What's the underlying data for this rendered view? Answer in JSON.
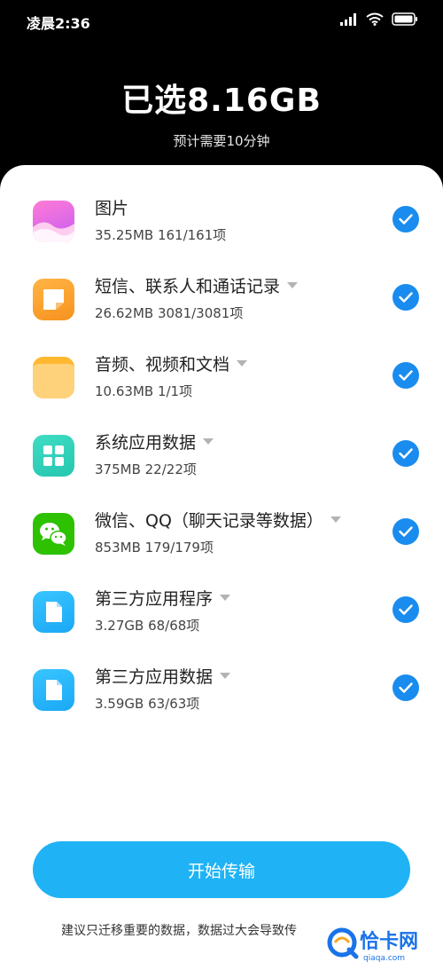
{
  "status_bar": {
    "time": "凌晨2:36"
  },
  "header": {
    "title": "已选8.16GB",
    "subtitle": "预计需要10分钟"
  },
  "items": [
    {
      "title": "图片",
      "meta": "35.25MB  161/161项",
      "has_dropdown": false,
      "checked": true,
      "icon": "gallery-icon"
    },
    {
      "title": "短信、联系人和通话记录",
      "meta": "26.62MB  3081/3081项",
      "has_dropdown": true,
      "checked": true,
      "icon": "messages-icon"
    },
    {
      "title": "音频、视频和文档",
      "meta": "10.63MB  1/1项",
      "has_dropdown": true,
      "checked": true,
      "icon": "folder-icon"
    },
    {
      "title": "系统应用数据",
      "meta": "375MB  22/22项",
      "has_dropdown": true,
      "checked": true,
      "icon": "apps-grid-icon"
    },
    {
      "title": "微信、QQ（聊天记录等数据）",
      "meta": "853MB  179/179项",
      "has_dropdown": true,
      "checked": true,
      "icon": "wechat-icon"
    },
    {
      "title": "第三方应用程序",
      "meta": "3.27GB  68/68项",
      "has_dropdown": true,
      "checked": true,
      "icon": "document-icon"
    },
    {
      "title": "第三方应用数据",
      "meta": "3.59GB  63/63项",
      "has_dropdown": true,
      "checked": true,
      "icon": "document-icon"
    }
  ],
  "start_button": {
    "label": "开始传输"
  },
  "footnote": "建议只迁移重要的数据，数据过大会导致传",
  "watermark": {
    "brand": "恰卡网",
    "domain": "qiaqa.com"
  },
  "colors": {
    "accent_blue": "#1a8cef",
    "button_blue": "#1fb3f5",
    "background": "#000000",
    "sheet": "#ffffff"
  }
}
